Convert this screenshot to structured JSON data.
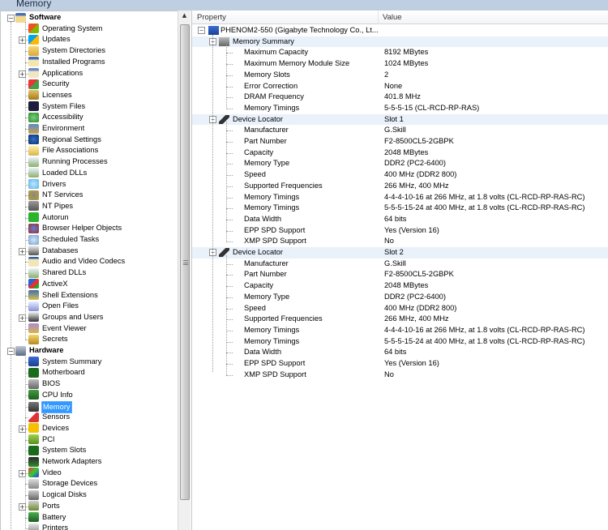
{
  "window": {
    "title": "Memory"
  },
  "tree": {
    "software": {
      "label": "Software",
      "items": [
        {
          "label": "Operating System",
          "icon": "windows-logo-icon",
          "expandable": false
        },
        {
          "label": "Updates",
          "icon": "windows-update-icon",
          "expandable": true
        },
        {
          "label": "System Directories",
          "icon": "folder-icon",
          "expandable": false
        },
        {
          "label": "Installed Programs",
          "icon": "programs-icon",
          "expandable": false
        },
        {
          "label": "Applications",
          "icon": "applications-icon",
          "expandable": true
        },
        {
          "label": "Security",
          "icon": "shield-icon",
          "expandable": false
        },
        {
          "label": "Licenses",
          "icon": "lock-icon",
          "expandable": false
        },
        {
          "label": "System Files",
          "icon": "console-icon",
          "expandable": false
        },
        {
          "label": "Accessibility",
          "icon": "accessibility-icon",
          "expandable": false
        },
        {
          "label": "Environment",
          "icon": "environment-icon",
          "expandable": false
        },
        {
          "label": "Regional Settings",
          "icon": "globe-icon",
          "expandable": false
        },
        {
          "label": "File Associations",
          "icon": "file-association-icon",
          "expandable": false
        },
        {
          "label": "Running Processes",
          "icon": "process-icon",
          "expandable": false
        },
        {
          "label": "Loaded DLLs",
          "icon": "dll-icon",
          "expandable": false
        },
        {
          "label": "Drivers",
          "icon": "drivers-icon",
          "expandable": false
        },
        {
          "label": "NT Services",
          "icon": "gears-icon",
          "expandable": false
        },
        {
          "label": "NT Pipes",
          "icon": "pipe-icon",
          "expandable": false
        },
        {
          "label": "Autorun",
          "icon": "autorun-icon",
          "expandable": false
        },
        {
          "label": "Browser Helper Objects",
          "icon": "browser-icon",
          "expandable": false
        },
        {
          "label": "Scheduled Tasks",
          "icon": "scheduled-tasks-icon",
          "expandable": false
        },
        {
          "label": "Databases",
          "icon": "database-icon",
          "expandable": true
        },
        {
          "label": "Audio and Video Codecs",
          "icon": "codec-icon",
          "expandable": false
        },
        {
          "label": "Shared DLLs",
          "icon": "shared-dll-icon",
          "expandable": false
        },
        {
          "label": "ActiveX",
          "icon": "activex-icon",
          "expandable": false
        },
        {
          "label": "Shell Extensions",
          "icon": "shell-extension-icon",
          "expandable": false
        },
        {
          "label": "Open Files",
          "icon": "file-icon",
          "expandable": false
        },
        {
          "label": "Groups and Users",
          "icon": "users-icon",
          "expandable": true
        },
        {
          "label": "Event Viewer",
          "icon": "event-viewer-icon",
          "expandable": false
        },
        {
          "label": "Secrets",
          "icon": "key-icon",
          "expandable": false
        }
      ]
    },
    "hardware": {
      "label": "Hardware",
      "items": [
        {
          "label": "System Summary",
          "icon": "computer-icon",
          "expandable": false
        },
        {
          "label": "Motherboard",
          "icon": "motherboard-icon",
          "expandable": false
        },
        {
          "label": "BIOS",
          "icon": "bios-chip-icon",
          "expandable": false
        },
        {
          "label": "CPU Info",
          "icon": "cpu-icon",
          "expandable": false
        },
        {
          "label": "Memory",
          "icon": "memory-icon",
          "expandable": false,
          "selected": true
        },
        {
          "label": "Sensors",
          "icon": "thermometer-icon",
          "expandable": false
        },
        {
          "label": "Devices",
          "icon": "devices-icon",
          "expandable": true
        },
        {
          "label": "PCI",
          "icon": "pci-icon",
          "expandable": false
        },
        {
          "label": "System Slots",
          "icon": "slots-icon",
          "expandable": false
        },
        {
          "label": "Network Adapters",
          "icon": "network-adapter-icon",
          "expandable": false
        },
        {
          "label": "Video",
          "icon": "monitor-icon",
          "expandable": true
        },
        {
          "label": "Storage Devices",
          "icon": "storage-icon",
          "expandable": false
        },
        {
          "label": "Logical Disks",
          "icon": "disk-icon",
          "expandable": false
        },
        {
          "label": "Ports",
          "icon": "port-icon",
          "expandable": true
        },
        {
          "label": "Battery",
          "icon": "battery-icon",
          "expandable": false
        },
        {
          "label": "Printers",
          "icon": "printer-icon",
          "expandable": false
        }
      ]
    }
  },
  "details": {
    "columns": {
      "property": "Property",
      "value": "Value"
    },
    "root": "PHENOM2-550 (Gigabyte Technology Co., Lt...",
    "summary": {
      "label": "Memory Summary",
      "rows": [
        {
          "property": "Maximum Capacity",
          "value": "8192 MBytes"
        },
        {
          "property": "Maximum Memory Module Size",
          "value": "1024 MBytes"
        },
        {
          "property": "Memory Slots",
          "value": "2"
        },
        {
          "property": "Error Correction",
          "value": "None"
        },
        {
          "property": "DRAM Frequency",
          "value": "401.8 MHz"
        },
        {
          "property": "Memory Timings",
          "value": "5-5-5-15 (CL-RCD-RP-RAS)"
        }
      ]
    },
    "slots": [
      {
        "label": "Device Locator",
        "value": "Slot 1",
        "rows": [
          {
            "property": "Manufacturer",
            "value": "G.Skill"
          },
          {
            "property": "Part Number",
            "value": "F2-8500CL5-2GBPK"
          },
          {
            "property": "Capacity",
            "value": "2048 MBytes"
          },
          {
            "property": "Memory Type",
            "value": "DDR2 (PC2-6400)"
          },
          {
            "property": "Speed",
            "value": "400 MHz (DDR2 800)"
          },
          {
            "property": "Supported Frequencies",
            "value": "266 MHz, 400 MHz"
          },
          {
            "property": "Memory Timings",
            "value": "4-4-4-10-16 at 266 MHz, at 1.8 volts (CL-RCD-RP-RAS-RC)"
          },
          {
            "property": "Memory Timings",
            "value": "5-5-5-15-24 at 400 MHz, at 1.8 volts (CL-RCD-RP-RAS-RC)"
          },
          {
            "property": "Data Width",
            "value": "64 bits"
          },
          {
            "property": "EPP SPD Support",
            "value": "Yes (Version 16)"
          },
          {
            "property": "XMP SPD Support",
            "value": "No"
          }
        ]
      },
      {
        "label": "Device Locator",
        "value": "Slot 2",
        "rows": [
          {
            "property": "Manufacturer",
            "value": "G.Skill"
          },
          {
            "property": "Part Number",
            "value": "F2-8500CL5-2GBPK"
          },
          {
            "property": "Capacity",
            "value": "2048 MBytes"
          },
          {
            "property": "Memory Type",
            "value": "DDR2 (PC2-6400)"
          },
          {
            "property": "Speed",
            "value": "400 MHz (DDR2 800)"
          },
          {
            "property": "Supported Frequencies",
            "value": "266 MHz, 400 MHz"
          },
          {
            "property": "Memory Timings",
            "value": "4-4-4-10-16 at 266 MHz, at 1.8 volts (CL-RCD-RP-RAS-RC)"
          },
          {
            "property": "Memory Timings",
            "value": "5-5-5-15-24 at 400 MHz, at 1.8 volts (CL-RCD-RP-RAS-RC)"
          },
          {
            "property": "Data Width",
            "value": "64 bits"
          },
          {
            "property": "EPP SPD Support",
            "value": "Yes (Version 16)"
          },
          {
            "property": "XMP SPD Support",
            "value": "No"
          }
        ]
      }
    ]
  },
  "colors": {
    "selection": "#3399ff",
    "row_highlight": "#e9f1fb",
    "titlebar": "#bfcfe1"
  }
}
